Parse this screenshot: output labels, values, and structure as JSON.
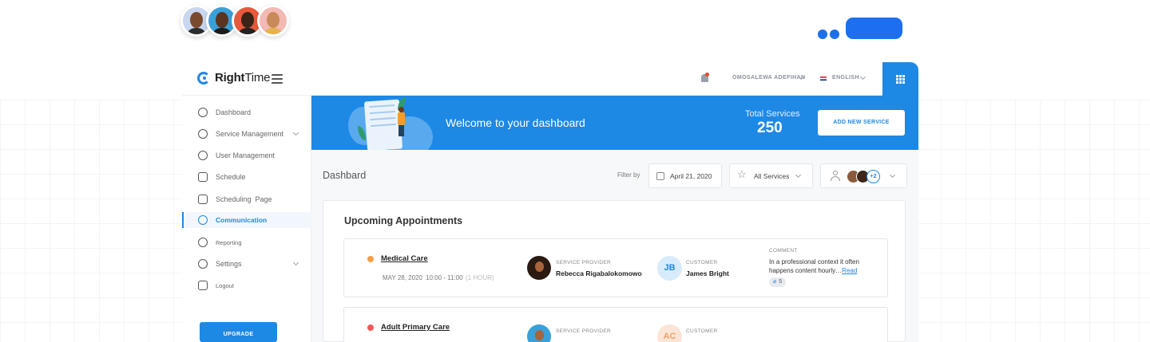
{
  "brand": {
    "name_bold": "Right",
    "name_thin": "Time"
  },
  "header": {
    "user_name": "OMOSALEWA ADEFIHAN",
    "language": "ENGLISH"
  },
  "sidebar": {
    "items": [
      {
        "label": "Dashboard",
        "icon": "gauge-icon"
      },
      {
        "label": "Service Management",
        "icon": "user-plus-icon",
        "has_chevron": true
      },
      {
        "label": "User Management",
        "icon": "user-chat-icon"
      },
      {
        "label": "Schedule",
        "icon": "calendar-icon"
      },
      {
        "label": "Scheduling  Page",
        "icon": "pages-icon"
      },
      {
        "label": "Communication",
        "icon": "message-icon",
        "active": true
      },
      {
        "label": "Reporting",
        "icon": "pie-chart-icon"
      },
      {
        "label": "Settings",
        "icon": "gear-icon",
        "has_chevron": true
      },
      {
        "label": "Logout",
        "icon": "logout-icon"
      }
    ],
    "upgrade_label": "UPGRADE"
  },
  "banner": {
    "welcome": "Welcome to your dashboard",
    "total_label": "Total Services",
    "total_value": "250",
    "add_button": "ADD NEW SERVICE"
  },
  "main": {
    "title": "Dashbard",
    "filter_label": "Filter by",
    "date_value": "April 21, 2020",
    "services_value": "All Services",
    "people_more": "+2"
  },
  "appointments": {
    "title": "Upcoming Appointments",
    "provider_label": "SERVICE PROVIDER",
    "customer_label": "CUSTOMER",
    "comment_label": "COMMENT",
    "rows": [
      {
        "name": "Medical Care",
        "status_color": "#f4a04a",
        "date": "MAY 28, 2020",
        "time": "10:00 - 11:00",
        "duration": "(1 HOUR)",
        "provider": "Rebecca Rigabalokomowo",
        "customer_initials": "JB",
        "customer": "James Bright",
        "comment": "In a professional context it often happens content hourly…",
        "read_link": "Read",
        "attachments": "5"
      },
      {
        "name": "Adult Primary Care",
        "status_color": "#f05a5a",
        "customer_initials": "AC"
      }
    ]
  },
  "colors": {
    "primary": "#1e88e5",
    "accent": "#1d6ff0"
  }
}
